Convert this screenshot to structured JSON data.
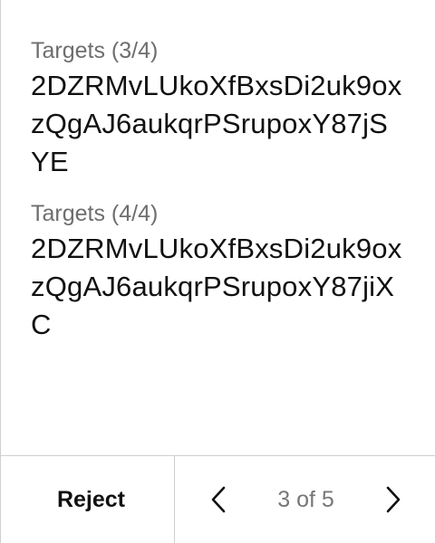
{
  "targets": [
    {
      "label": "Targets (3/4)",
      "value": "2DZRMvLUkoXfBxsDi2uk9oxzQgAJ6aukqrPSrupoxY87jSYE"
    },
    {
      "label": "Targets (4/4)",
      "value": "2DZRMvLUkoXfBxsDi2uk9oxzQgAJ6aukqrPSrupoxY87jiXC"
    }
  ],
  "footer": {
    "reject_label": "Reject",
    "page_indicator": "3 of 5",
    "prev_icon": "chevron-left-icon",
    "next_icon": "chevron-right-icon"
  },
  "colors": {
    "label": "#6e6e6e",
    "value": "#111111",
    "divider": "#cfcfcf",
    "page_indicator": "#777777"
  }
}
